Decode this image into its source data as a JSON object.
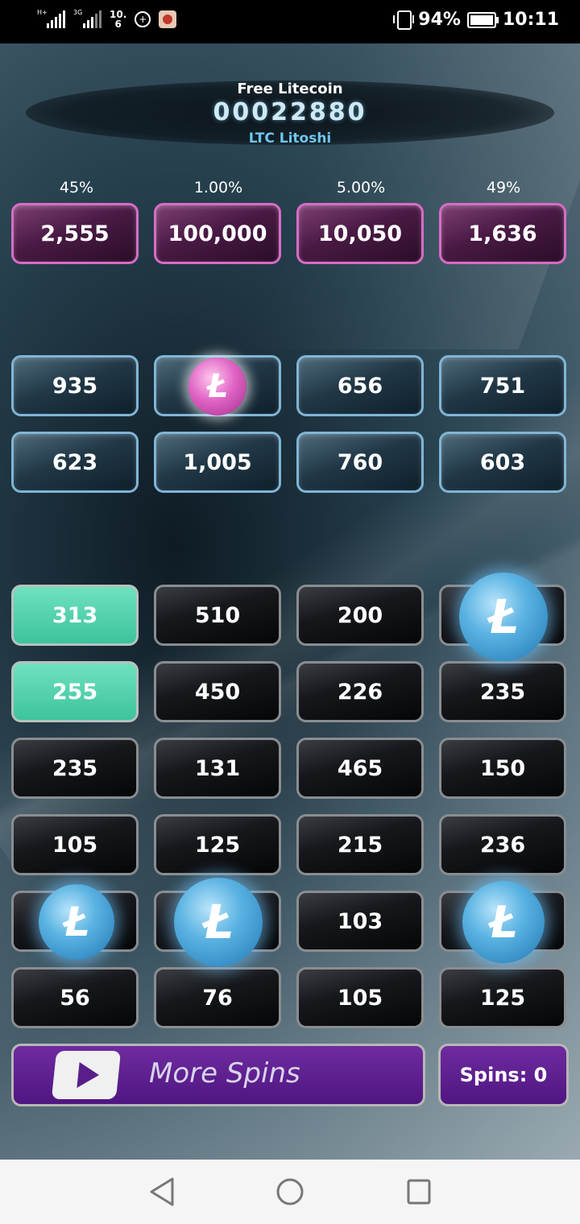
{
  "status_bar": {
    "network1": "H+",
    "network2": "3G",
    "time_small_top": "10.",
    "time_small_bottom": "6",
    "battery": "94%",
    "time": "10:11"
  },
  "header": {
    "title": "Free Litecoin",
    "counter": "00022880",
    "subtitle": "LTC Litoshi"
  },
  "jackpots": [
    {
      "percent": "45%",
      "value": "2,555"
    },
    {
      "percent": "1.00%",
      "value": "100,000"
    },
    {
      "percent": "5.00%",
      "value": "10,050"
    },
    {
      "percent": "49%",
      "value": "1,636"
    }
  ],
  "mid_rows": [
    [
      "935",
      "",
      "656",
      "751"
    ],
    [
      "623",
      "1,005",
      "760",
      "603"
    ]
  ],
  "grid_rows": [
    [
      "313",
      "510",
      "200",
      ""
    ],
    [
      "255",
      "450",
      "226",
      "235"
    ],
    [
      "235",
      "131",
      "465",
      "150"
    ],
    [
      "105",
      "125",
      "215",
      "236"
    ],
    [
      "",
      "",
      "103",
      ""
    ],
    [
      "56",
      "76",
      "105",
      "125"
    ]
  ],
  "coin_symbol": "Ł",
  "more_spins_label": "More Spins",
  "spins_label": "Spins: 0",
  "colors": {
    "pink_border": "#d86cc6",
    "blue_border": "#7fb5d6",
    "green_tile": "#4fd2ab",
    "purple_button": "#5f2093",
    "subtitle_blue": "#6fc6ee"
  }
}
